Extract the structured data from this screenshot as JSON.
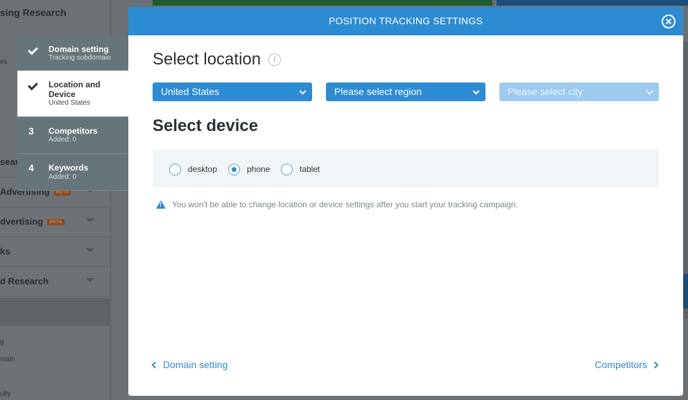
{
  "background": {
    "sidebar_title": "sing Research",
    "sidebar_items": [
      {
        "label": "searc",
        "top": 0
      },
      {
        "label": "Advertising",
        "beta": "BETA"
      },
      {
        "label": "dvertising",
        "beta": "BETA"
      },
      {
        "label": "ks"
      },
      {
        "label": "d Research"
      }
    ],
    "small_texts": [
      "es",
      "g",
      "main",
      "ulty"
    ]
  },
  "wizard_steps": [
    {
      "mark": "check",
      "title": "Domain setting",
      "sub": "Tracking subdomain"
    },
    {
      "mark": "check",
      "title": "Location and Device",
      "sub": "United States"
    },
    {
      "mark": "3",
      "title": "Competitors",
      "sub": "Added: 0"
    },
    {
      "mark": "4",
      "title": "Keywords",
      "sub": "Added: 0"
    }
  ],
  "modal": {
    "title": "POSITION TRACKING SETTINGS",
    "location_heading": "Select location",
    "info_glyph": "i",
    "country_value": "United States",
    "region_value": "Please select region",
    "city_value": "Please select city",
    "device_heading": "Select device",
    "devices": [
      {
        "label": "desktop",
        "checked": false
      },
      {
        "label": "phone",
        "checked": true
      },
      {
        "label": "tablet",
        "checked": false
      }
    ],
    "warning_text": "You won't be able to change location or device settings after you start your tracking campaign.",
    "back_link": "Domain setting",
    "next_link": "Competitors"
  },
  "colors": {
    "accent": "#2c8bd1",
    "header": "#2c8bd1",
    "step_bg": "#667579"
  }
}
